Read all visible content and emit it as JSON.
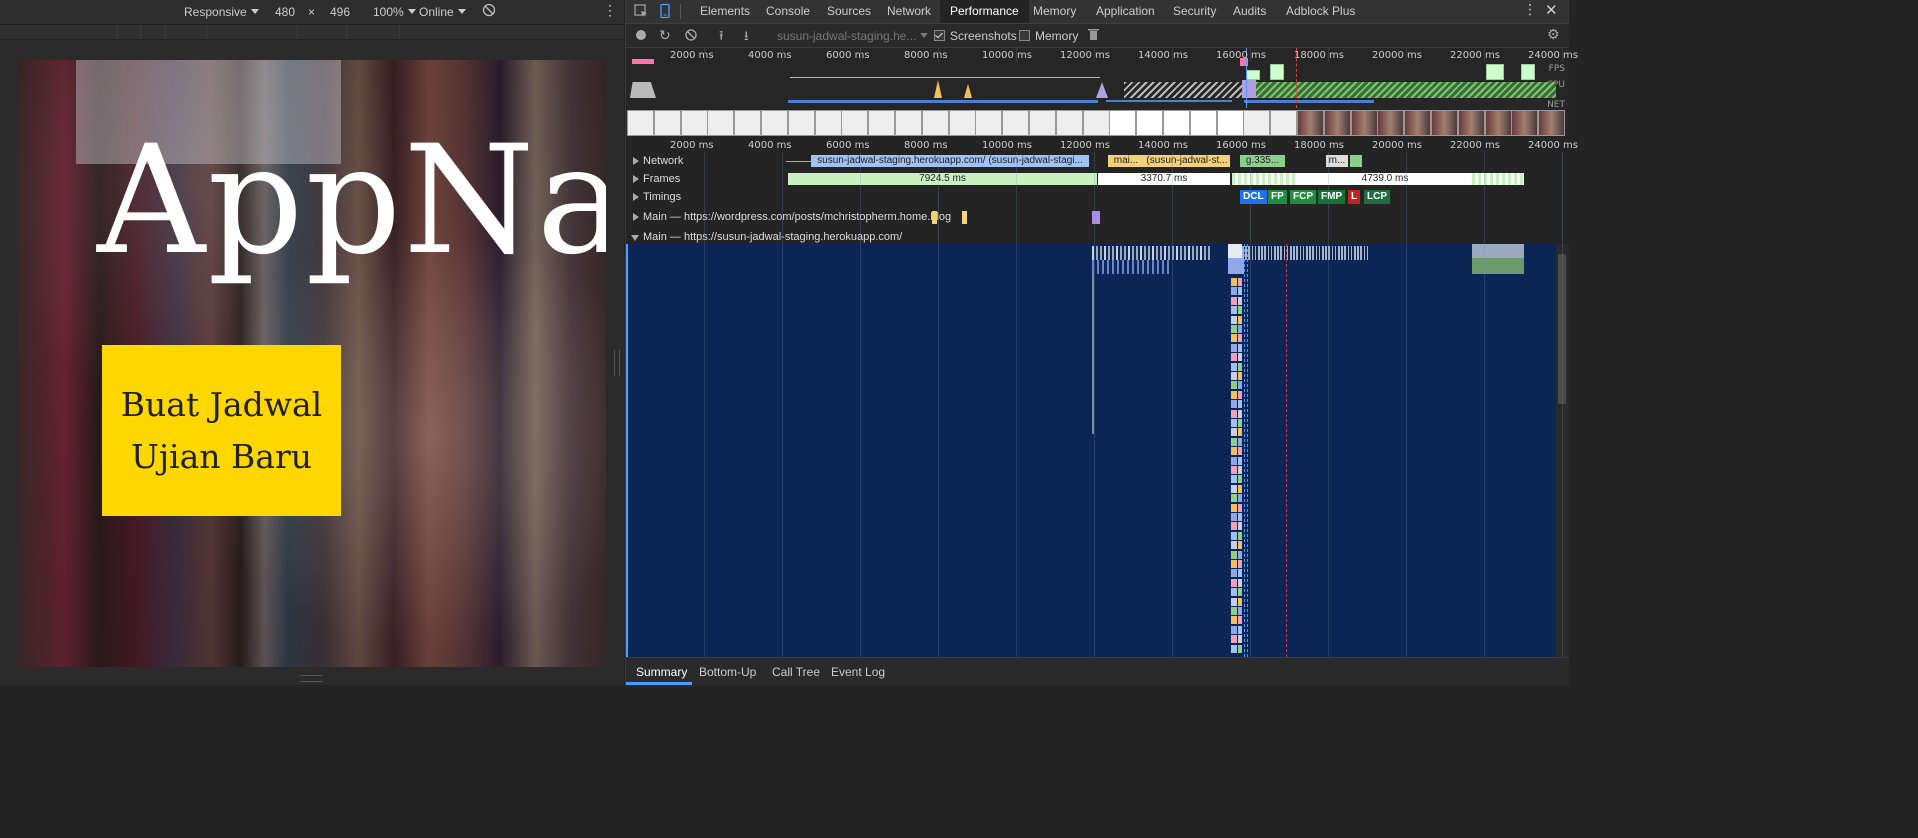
{
  "device_toolbar": {
    "mode": "Responsive",
    "width": "480",
    "times": "×",
    "height": "496",
    "zoom": "100%",
    "network": "Online"
  },
  "page": {
    "app_name": "AppNa",
    "cta_label": "Buat Jadwal Ujian Baru"
  },
  "devtools": {
    "tabs": [
      "Elements",
      "Console",
      "Sources",
      "Network",
      "Performance",
      "Memory",
      "Application",
      "Security",
      "Audits",
      "Adblock Plus"
    ],
    "active_tab": "Performance",
    "toolbar": {
      "recording": "susun-jadwal-staging.he...",
      "screenshots_label": "Screenshots",
      "memory_label": "Memory"
    },
    "overview_ticks": [
      "2000 ms",
      "4000 ms",
      "6000 ms",
      "8000 ms",
      "10000 ms",
      "12000 ms",
      "14000 ms",
      "16000 ms",
      "18000 ms",
      "20000 ms",
      "22000 ms",
      "24000 ms"
    ],
    "overview_labels": {
      "fps": "FPS",
      "cpu": "CPU",
      "net": "NET"
    },
    "timeline_ticks": [
      "2000 ms",
      "4000 ms",
      "6000 ms",
      "8000 ms",
      "10000 ms",
      "12000 ms",
      "14000 ms",
      "16000 ms",
      "18000 ms",
      "20000 ms",
      "22000 ms",
      "24000 ms"
    ],
    "tracks": {
      "network": "Network",
      "frames": "Frames",
      "timings": "Timings",
      "main1": "Main — https://wordpress.com/posts/mchristopherm.home.blog",
      "main2": "Main — https://susun-jadwal-staging.herokuapp.com/"
    },
    "network_bars": [
      "susun-jadwal-staging.herokuapp.com/ (susun-jadwal-stagi...",
      "mai...",
      "(susun-jadwal-st...",
      "g.335...",
      "m..."
    ],
    "frame_bars": [
      "7924.5 ms",
      "3370.7 ms",
      "4739.0 ms"
    ],
    "timing_badges": [
      {
        "label": "DCL",
        "color": "#1a73e8"
      },
      {
        "label": "FP",
        "color": "#1e8e3e"
      },
      {
        "label": "FCP",
        "color": "#1e8e3e"
      },
      {
        "label": "FMP",
        "color": "#137333"
      },
      {
        "label": "L",
        "color": "#c5221f"
      },
      {
        "label": "LCP",
        "color": "#1e6e3e"
      }
    ],
    "summary_tabs": [
      "Summary",
      "Bottom-Up",
      "Call Tree",
      "Event Log"
    ],
    "active_summary_tab": "Summary"
  }
}
